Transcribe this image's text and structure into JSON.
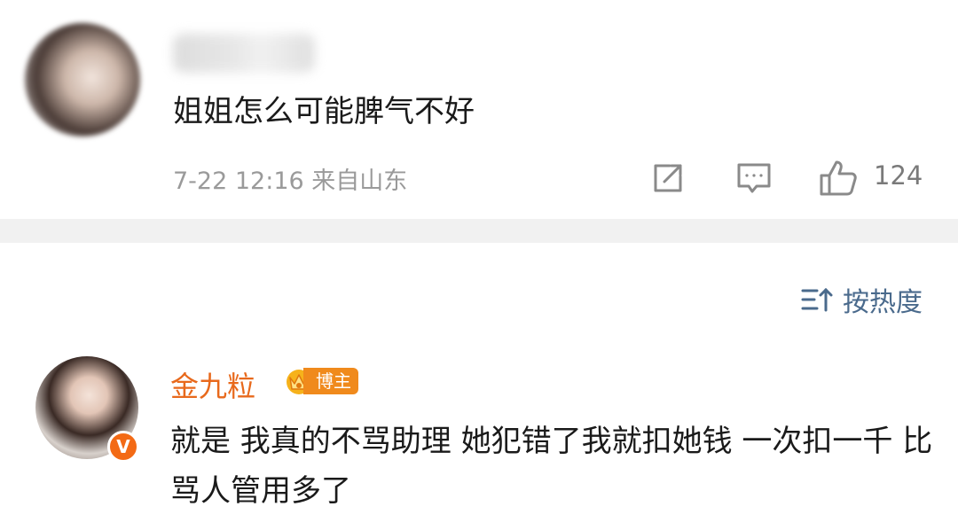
{
  "comment": {
    "text": "姐姐怎么可能脾气不好",
    "time_location": "7-22 12:16  来自山东",
    "like_count": "124",
    "icons": [
      "share-icon",
      "comment-icon",
      "like-icon"
    ]
  },
  "sort": {
    "label": "按热度",
    "icon": "sort-icon"
  },
  "reply": {
    "username": "金九粒",
    "badge_label": "博主",
    "verified_mark": "V",
    "text": "就是 我真的不骂助理 她犯错了我就扣她钱 一次扣一千 比骂人管用多了"
  },
  "colors": {
    "username_orange": "#e8691c",
    "sort_blue": "#4a6a8c",
    "meta_gray": "#9a9a9a",
    "badge_orange": "#f08a1c"
  }
}
